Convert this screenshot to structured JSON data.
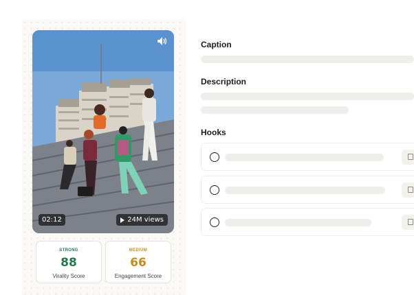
{
  "video": {
    "duration": "02:12",
    "views": "24M views"
  },
  "scores": [
    {
      "label": "STRONG",
      "value": "88",
      "name": "Virality Score",
      "color": "#1f7a4a"
    },
    {
      "label": "MEDIUM",
      "value": "66",
      "name": "Engagement Score",
      "color": "#c98a1a"
    }
  ],
  "sections": {
    "caption": "Caption",
    "description": "Description",
    "hooks": "Hooks"
  },
  "icons": {
    "sound": "speaker-icon",
    "play": "play-icon",
    "copy": "copy-icon",
    "radio": "radio-icon"
  }
}
